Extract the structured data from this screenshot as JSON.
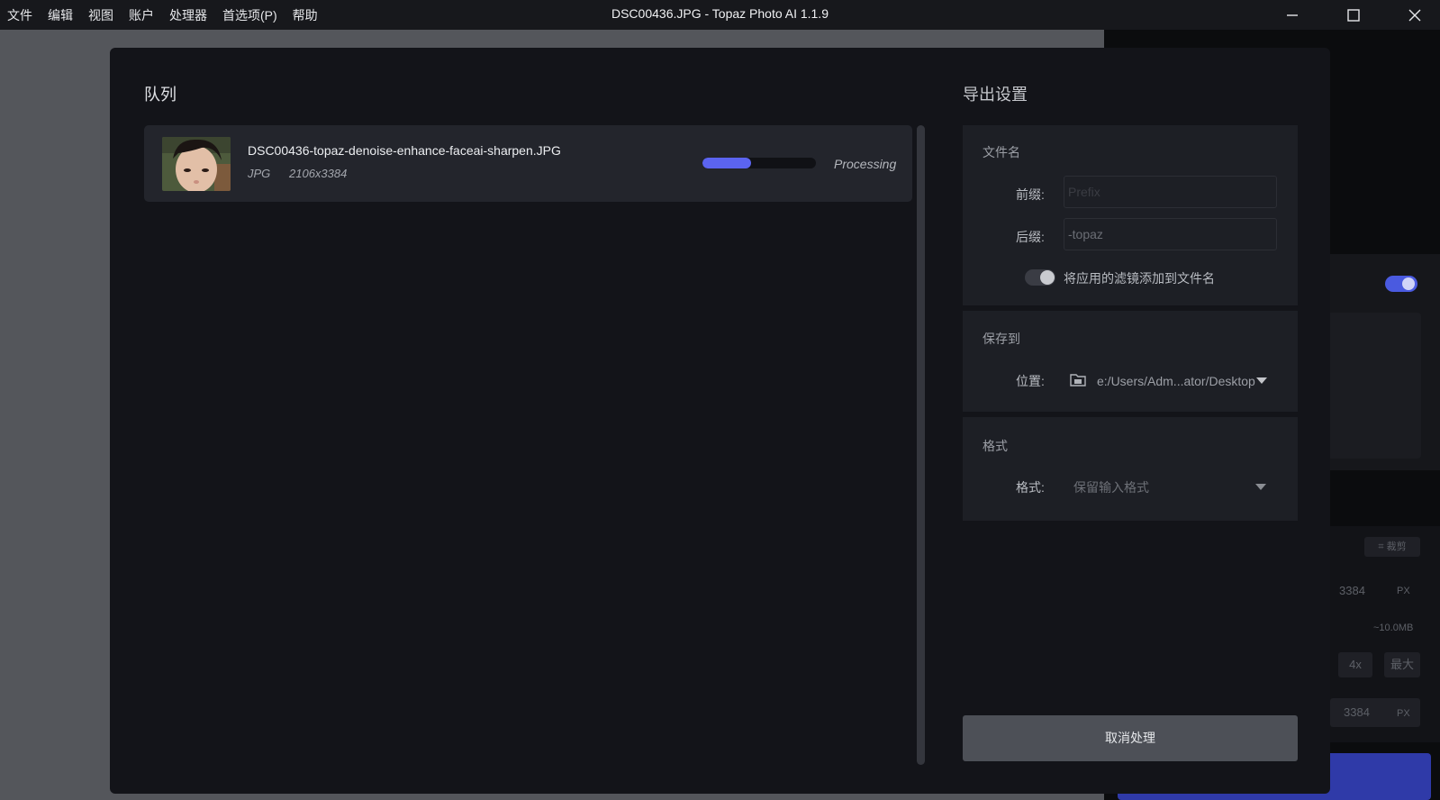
{
  "menu": [
    "文件",
    "编辑",
    "视图",
    "账户",
    "处理器",
    "首选项(P)",
    "帮助"
  ],
  "window_title": "DSC00436.JPG - Topaz Photo AI 1.1.9",
  "background": {
    "crop_label": "裁剪",
    "height_value": "3384",
    "width_value": "3384",
    "px_unit": "PX",
    "size_estimate": "~10.0MB",
    "scale_4x": "4x",
    "scale_max": "最大"
  },
  "modal": {
    "queue_title": "队列",
    "export_title": "导出设置",
    "queue_items": [
      {
        "file_name": "DSC00436-topaz-denoise-enhance-faceai-sharpen.JPG",
        "ext": "JPG",
        "dims": "2106x3384",
        "progress": 0.43,
        "status": "Processing"
      }
    ],
    "colors": {
      "accent": "#5b64f0"
    },
    "filename_section": {
      "title": "文件名",
      "prefix_label": "前缀:",
      "prefix_placeholder": "Prefix",
      "prefix_value": "",
      "suffix_label": "后缀:",
      "suffix_value": "-topaz",
      "toggle_label": "将应用的滤镜添加到文件名",
      "toggle_on": false
    },
    "save_section": {
      "title": "保存到",
      "location_label": "位置:",
      "location_value": "e:/Users/Adm...ator/Desktop",
      "icon": "folder-icon"
    },
    "format_section": {
      "title": "格式",
      "format_label": "格式:",
      "format_value": "保留输入格式"
    },
    "cancel_button": "取消处理"
  }
}
